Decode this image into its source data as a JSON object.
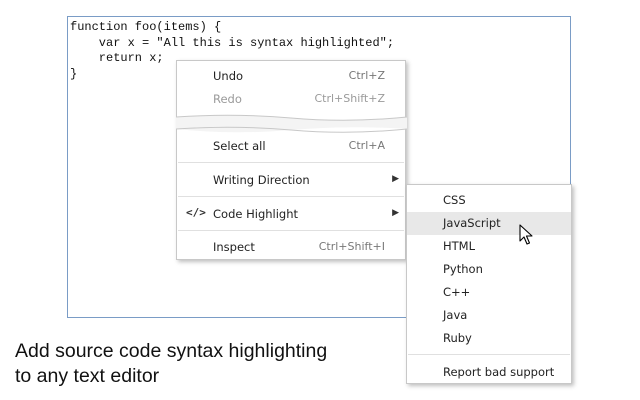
{
  "editor": {
    "lines": [
      "function foo(items) {",
      "    var x = \"All this is syntax highlighted\";",
      "    return x;",
      "}"
    ]
  },
  "context_menu": {
    "undo": {
      "label": "Undo",
      "shortcut": "Ctrl+Z"
    },
    "redo": {
      "label": "Redo",
      "shortcut": "Ctrl+Shift+Z"
    },
    "select_all": {
      "label": "Select all",
      "shortcut": "Ctrl+A"
    },
    "writing_direction": {
      "label": "Writing Direction"
    },
    "code_highlight": {
      "label": "Code Highlight",
      "icon": "</>"
    },
    "inspect": {
      "label": "Inspect",
      "shortcut": "Ctrl+Shift+I"
    }
  },
  "submenu": {
    "languages": [
      "CSS",
      "JavaScript",
      "HTML",
      "Python",
      "C++",
      "Java",
      "Ruby"
    ],
    "highlighted": "JavaScript",
    "report": "Report bad support"
  },
  "caption": {
    "line1": "Add source code syntax highlighting",
    "line2": "to any text editor"
  },
  "colors": {
    "editor_border": "#7a9cc6",
    "highlight": "#e8e8e8"
  }
}
